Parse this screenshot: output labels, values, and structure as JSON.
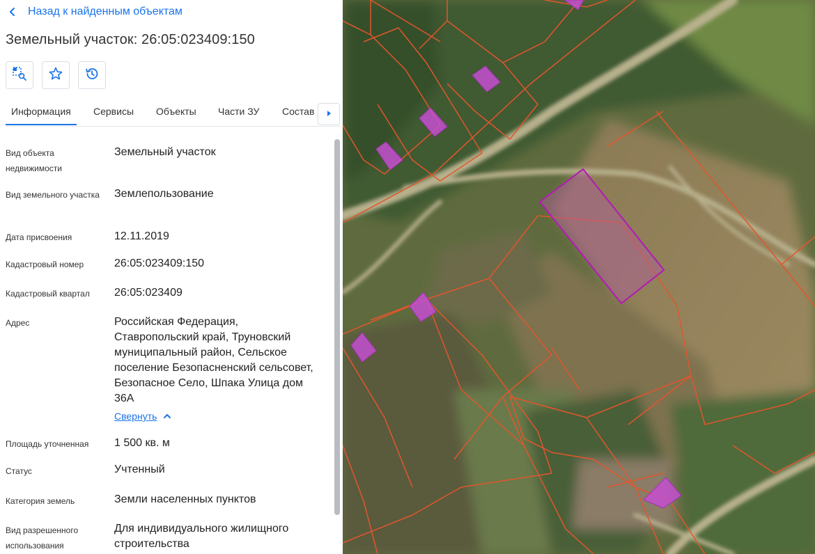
{
  "header": {
    "back_label": "Назад к найденным объектам",
    "title": "Земельный участок: 26:05:023409:150"
  },
  "toolbar": {
    "icons": [
      "search-area-icon",
      "star-icon",
      "history-icon"
    ]
  },
  "tabs": [
    {
      "label": "Информация",
      "active": true
    },
    {
      "label": "Сервисы",
      "active": false
    },
    {
      "label": "Объекты",
      "active": false
    },
    {
      "label": "Части ЗУ",
      "active": false
    },
    {
      "label": "Состав",
      "active": false
    }
  ],
  "info": {
    "object_type_label": "Вид объекта недвижимости",
    "object_type_value": "Земельный участок",
    "plot_type_label": "Вид земельного участка",
    "plot_type_value": "Землепользование",
    "date_label": "Дата присвоения",
    "date_value": "12.11.2019",
    "cad_number_label": "Кадастровый номер",
    "cad_number_value": "26:05:023409:150",
    "cad_quarter_label": "Кадастровый квартал",
    "cad_quarter_value": "26:05:023409",
    "address_label": "Адрес",
    "address_value": "Российская Федерация, Ставропольский край, Труновский муниципальный район, Сельское поселение Безопасненский сельсовет, Безопасное Село, Шпака Улица дом 36А",
    "collapse_label": "Свернуть",
    "area_label": "Площадь уточненная",
    "area_value": "1 500 кв. м",
    "status_label": "Статус",
    "status_value": "Учтенный",
    "land_category_label": "Категория земель",
    "land_category_value": "Земли населенных пунктов",
    "permitted_use_label": "Вид разрешенного использования",
    "permitted_use_value": "Для индивидуального жилищного строительства"
  },
  "colors": {
    "accent": "#1a73e8",
    "parcel_border": "#e2562c",
    "selected_parcel": "#b020b0",
    "building_fill": "#c44fd0"
  }
}
